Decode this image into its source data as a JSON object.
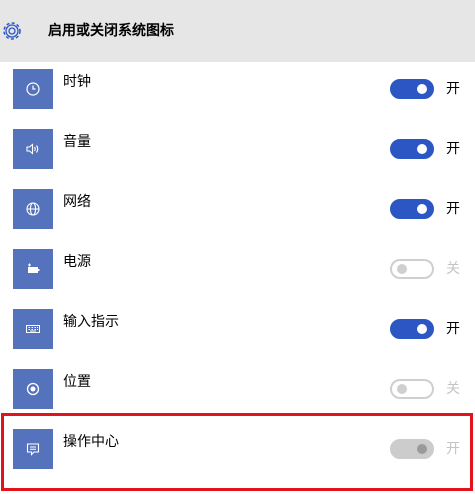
{
  "header": {
    "title": "启用或关闭系统图标",
    "icon": "gear-icon"
  },
  "colors": {
    "header_bg": "#e6e6e6",
    "icon_tile": "#5573bc",
    "toggle_on": "#2b56c4",
    "toggle_off_border": "#cfcfcf",
    "toggle_disabled": "#cccccc",
    "highlight": "#e1141e"
  },
  "items": [
    {
      "label": "时钟",
      "icon": "clock-icon",
      "state": "on",
      "state_label": "开"
    },
    {
      "label": "音量",
      "icon": "volume-icon",
      "state": "on",
      "state_label": "开"
    },
    {
      "label": "网络",
      "icon": "network-globe-icon",
      "state": "on",
      "state_label": "开"
    },
    {
      "label": "电源",
      "icon": "power-battery-icon",
      "state": "off",
      "state_label": "关"
    },
    {
      "label": "输入指示",
      "icon": "keyboard-icon",
      "state": "on",
      "state_label": "开"
    },
    {
      "label": "位置",
      "icon": "location-icon",
      "state": "off",
      "state_label": "关"
    },
    {
      "label": "操作中心",
      "icon": "action-center-icon",
      "state": "disabled-on",
      "state_label": "开",
      "highlighted": true
    }
  ]
}
